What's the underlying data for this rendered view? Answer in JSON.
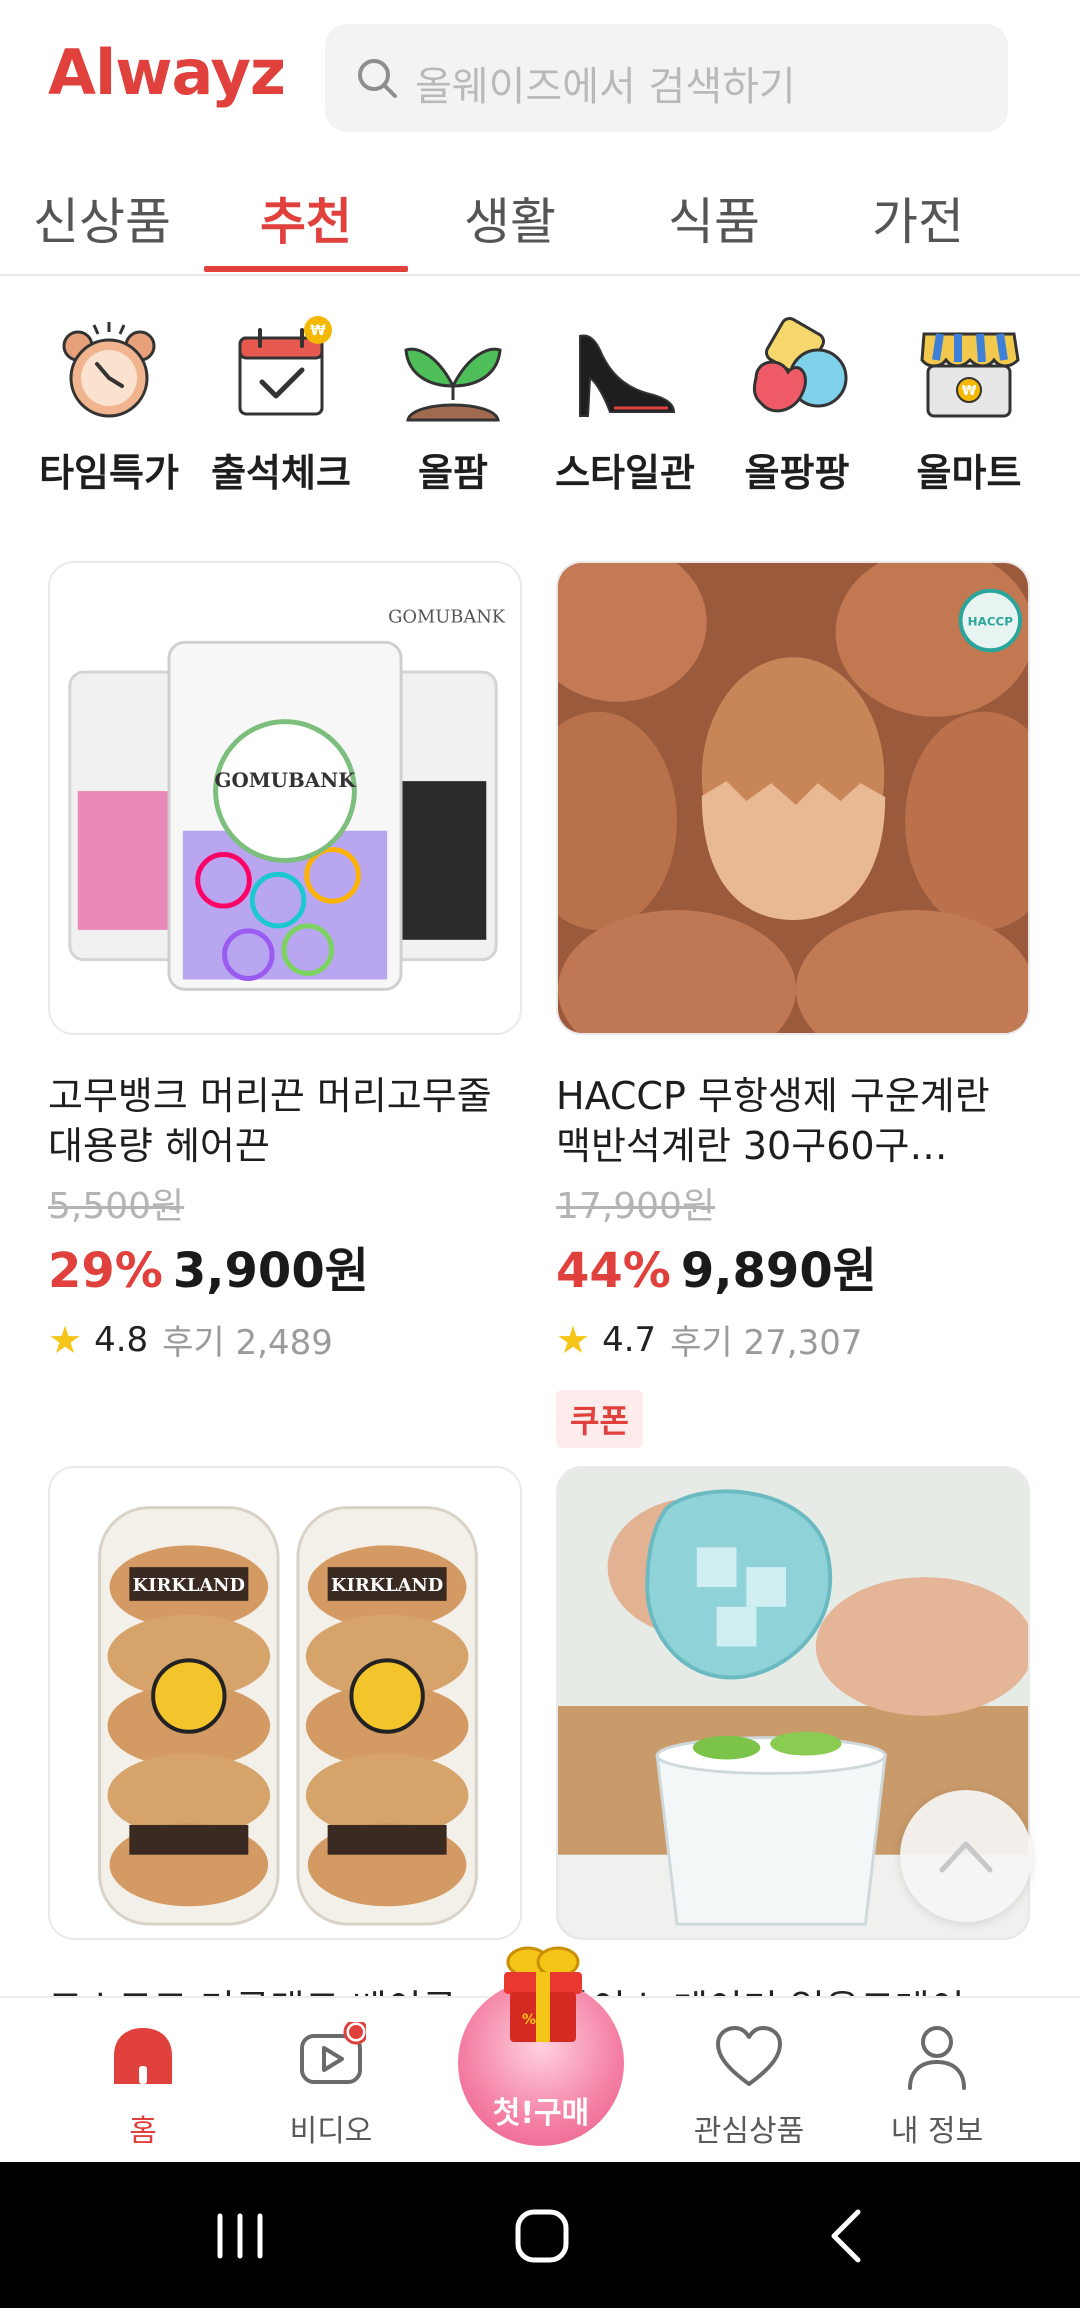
{
  "header": {
    "logo": "Alwayz",
    "search_placeholder": "올웨이즈에서 검색하기"
  },
  "tabs": [
    {
      "label": "신상품"
    },
    {
      "label": "추천"
    },
    {
      "label": "생활"
    },
    {
      "label": "식품"
    },
    {
      "label": "가전"
    }
  ],
  "active_tab": "추천",
  "shortcuts": [
    {
      "label": "타임특가",
      "icon": "alarm-clock-icon"
    },
    {
      "label": "출석체크",
      "icon": "calendar-check-icon"
    },
    {
      "label": "올팜",
      "icon": "sprout-icon"
    },
    {
      "label": "스타일관",
      "icon": "high-heel-icon"
    },
    {
      "label": "올팡팡",
      "icon": "jelly-candy-icon"
    },
    {
      "label": "올마트",
      "icon": "store-icon"
    }
  ],
  "products": [
    {
      "title": "고무뱅크 머리끈 머리고무줄 대용량 헤어끈",
      "original_price": "5,500원",
      "discount": "29%",
      "price": "3,900원",
      "rating": "4.8",
      "reviews": "후기 2,489",
      "brand_text": "GOMUBANK"
    },
    {
      "title": "HACCP 무항생제 구운계란 맥반석계란 30구60구…",
      "original_price": "17,900원",
      "discount": "44%",
      "price": "9,890원",
      "rating": "4.7",
      "reviews": "후기 27,307",
      "coupon": "쿠폰",
      "badge_text": "HACCP"
    },
    {
      "title": "코스트코 커클랜드 베이글",
      "brand_text": "KIRKLAND"
    },
    {
      "title": "아이스 메이커 얼음트레이"
    }
  ],
  "bottom_nav": [
    {
      "label": "홈",
      "icon": "home-icon"
    },
    {
      "label": "비디오",
      "icon": "video-icon"
    },
    {
      "label": "첫!구매",
      "icon": "gift-icon"
    },
    {
      "label": "관심상품",
      "icon": "heart-icon"
    },
    {
      "label": "내 정보",
      "icon": "person-icon"
    }
  ],
  "colors": {
    "accent": "#e0413d",
    "coupon_bg": "#fdeceb",
    "star": "#f5c518",
    "first_buy": "#f47fa3"
  }
}
